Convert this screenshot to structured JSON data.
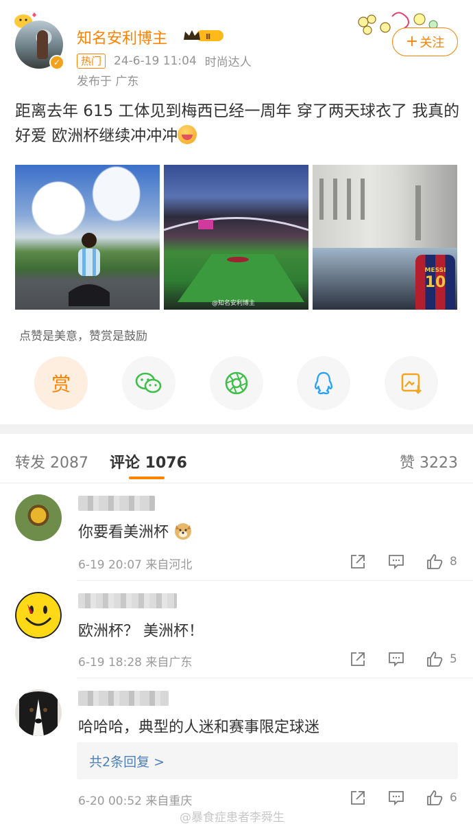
{
  "post": {
    "author": "知名安利博主",
    "hot_tag": "热门",
    "time": "24-6-19 11:04",
    "badge": "时尚达人",
    "location": "发布于 广东",
    "follow_label": "关注",
    "text": "距离去年 615 工体见到梅西已经一周年 穿了两天球衣了 我真的好爱 欧洲杯继续冲冲冲",
    "images": [
      {
        "icon": "girl-in-argentina-jersey-photo"
      },
      {
        "icon": "stadium-pitch-photo",
        "watermark": "@知名安利博主"
      },
      {
        "icon": "stadium-crowd-messi-jersey-photo",
        "jersey_text": "MESSI",
        "jersey_number": "10"
      }
    ],
    "reward_caption": "点赞是美意，赞赏是鼓励",
    "reward_label": "赏",
    "share_icons": [
      "wechat-icon",
      "moments-icon",
      "qq-icon",
      "save-image-icon"
    ]
  },
  "tabs": {
    "repost": "转发 2087",
    "comments": "评论 1076",
    "likes": "赞 3223"
  },
  "comments": [
    {
      "text": "你要看美洲杯",
      "meta": "6-19 20:07  来自河北",
      "likes": "8"
    },
    {
      "text": "欧洲杯？  美洲杯！",
      "meta": "6-19 18:28  来自广东",
      "likes": "5"
    },
    {
      "text": "哈哈哈，典型的人迷和赛事限定球迷",
      "meta": "6-20 00:52  来自重庆",
      "likes": "6",
      "replies_label": "共2条回复 >"
    }
  ],
  "footer_watermark": "@暴食症患者李舜生",
  "colors": {
    "accent": "#ff8200",
    "link": "#4e7fb5"
  }
}
